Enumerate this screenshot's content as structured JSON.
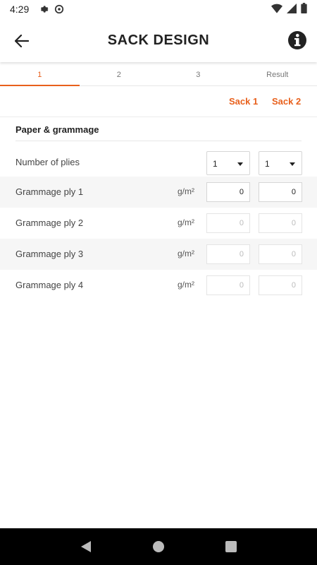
{
  "status_bar": {
    "time": "4:29",
    "icons": [
      "gear-icon",
      "at-sign-icon"
    ],
    "right_icons": [
      "wifi-icon",
      "signal-icon",
      "battery-icon"
    ]
  },
  "app_bar": {
    "title": "SACK DESIGN",
    "back_icon": "arrow-left-icon",
    "info_icon": "info-icon"
  },
  "tabs": [
    {
      "label": "1",
      "active": true
    },
    {
      "label": "2",
      "active": false
    },
    {
      "label": "3",
      "active": false
    },
    {
      "label": "Result",
      "active": false
    }
  ],
  "sack_header": {
    "sack1": "Sack 1",
    "sack2": "Sack 2"
  },
  "section": {
    "title": "Paper & grammage"
  },
  "rows": {
    "plies": {
      "label": "Number of plies",
      "sack1": "1",
      "sack2": "1"
    },
    "ply1": {
      "label": "Grammage ply 1",
      "unit": "g/m²",
      "sack1": "0",
      "sack2": "0"
    },
    "ply2": {
      "label": "Grammage ply 2",
      "unit": "g/m²",
      "sack1": "0",
      "sack2": "0"
    },
    "ply3": {
      "label": "Grammage ply 3",
      "unit": "g/m²",
      "sack1": "0",
      "sack2": "0"
    },
    "ply4": {
      "label": "Grammage ply 4",
      "unit": "g/m²",
      "sack1": "0",
      "sack2": "0"
    }
  },
  "colors": {
    "accent": "#e8601c",
    "row_shade": "#f6f6f6"
  },
  "nav_bar": {
    "icons": [
      "back-triangle-icon",
      "home-circle-icon",
      "recents-square-icon"
    ]
  }
}
